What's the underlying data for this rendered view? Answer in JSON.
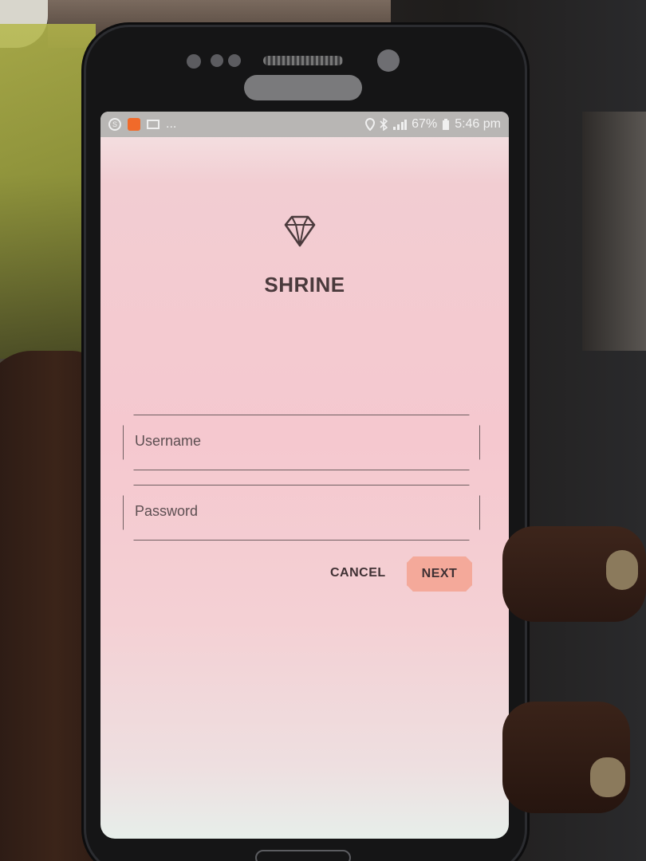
{
  "status_bar": {
    "notification_icons": [
      "s-icon",
      "app-icon",
      "mail-icon"
    ],
    "overflow": "...",
    "battery": "67%",
    "time": "5:46 pm"
  },
  "app": {
    "logo_icon": "diamond-icon",
    "title": "SHRINE"
  },
  "login_form": {
    "username_placeholder": "Username",
    "password_placeholder": "Password",
    "cancel_label": "CANCEL",
    "next_label": "NEXT"
  },
  "colors": {
    "screen_background": "#f5c8cf",
    "next_button": "#f4a99a",
    "text": "#4a3a3c"
  }
}
